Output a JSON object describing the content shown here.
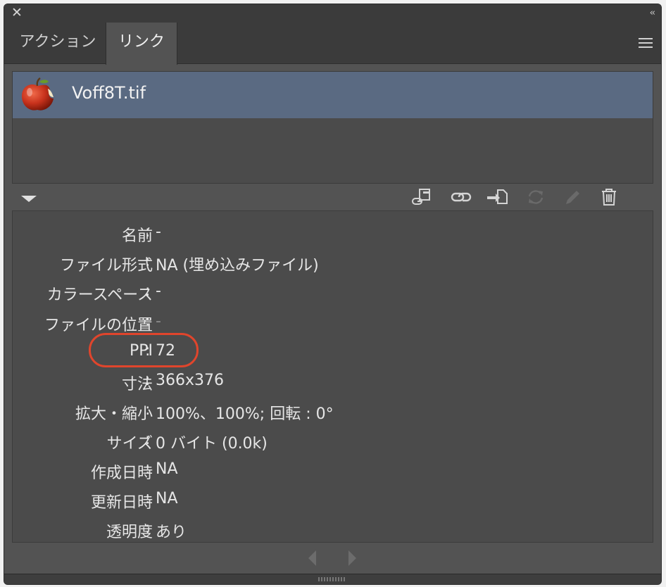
{
  "window": {
    "close_glyph": "✕",
    "collapse_glyph": "‹‹"
  },
  "tabs": [
    {
      "label": "アクション",
      "active": false
    },
    {
      "label": "リンク",
      "active": true
    }
  ],
  "links": [
    {
      "name": "Voff8T.tif",
      "selected": true,
      "thumbnail_icon": "apple-thumbnail-icon"
    }
  ],
  "toolbar": {
    "icons": [
      "relink-from-libraries-icon",
      "relink-icon",
      "go-to-link-icon",
      "update-link-icon",
      "edit-original-icon",
      "delete-icon"
    ],
    "disabled": [
      "update-link-icon",
      "edit-original-icon"
    ]
  },
  "info": {
    "colon": ":",
    "rows": [
      {
        "label": "名前",
        "value": "-"
      },
      {
        "label": "ファイル形式",
        "value": "NA (埋め込みファイル)"
      },
      {
        "label": "カラースペース",
        "value": "-"
      },
      {
        "label": "ファイルの位置",
        "value": "-"
      },
      {
        "label": "PPI",
        "value": "72"
      },
      {
        "label": "寸法",
        "value": "366x376"
      },
      {
        "label": "拡大・縮小",
        "value": "100%、100%; 回転 : 0°"
      },
      {
        "label": "サイズ",
        "value": "0 バイト (0.0k)"
      },
      {
        "label": "作成日時",
        "value": "NA"
      },
      {
        "label": "更新日時",
        "value": "NA"
      },
      {
        "label": "透明度",
        "value": "あり"
      }
    ]
  },
  "colors": {
    "panel_bg": "#535353",
    "selection_bg": "#5a6a82",
    "highlight_oval": "#e0452c"
  }
}
